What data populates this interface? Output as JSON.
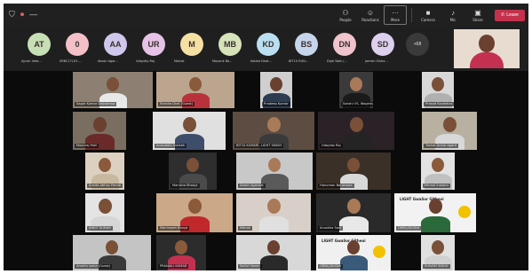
{
  "toolbar": {
    "shield_icon": "shield-icon",
    "record_indicator": "⏺",
    "timer": "—",
    "buttons": [
      {
        "label": "People",
        "icon": "people-icon"
      },
      {
        "label": "Reactions",
        "icon": "reactions-icon"
      },
      {
        "label": "More",
        "icon": "more-icon"
      },
      {
        "label": "Camera",
        "icon": "camera-icon"
      },
      {
        "label": "Mic",
        "icon": "mic-icon"
      },
      {
        "label": "Share",
        "icon": "share-icon"
      }
    ],
    "leave_label": "Leave",
    "leave_color": "#c4314b"
  },
  "strip": {
    "participants": [
      {
        "initials": "AT",
        "name": "Ayush Veta...",
        "color": "#c7dfb5"
      },
      {
        "initials": "0",
        "name": "0RBC17/1f1...",
        "color": "#f3c0c8"
      },
      {
        "initials": "AA",
        "name": "Akash Agar...",
        "color": "#cfc8ec"
      },
      {
        "initials": "UR",
        "name": "Udaydip Raj",
        "color": "#e6c2e6"
      },
      {
        "initials": "M",
        "name": "Mahak",
        "color": "#f5e0a3"
      },
      {
        "initials": "MB",
        "name": "Mayank Bo...",
        "color": "#d6e3b9"
      },
      {
        "initials": "KD",
        "name": "Kalata Dhat...",
        "color": "#b9dff0"
      },
      {
        "initials": "BS",
        "name": "BIT10 RUN...",
        "color": "#c6d4ec"
      },
      {
        "initials": "DN",
        "name": "Dipti Naik (...",
        "color": "#efc4cc"
      },
      {
        "initials": "SD",
        "name": "jomish Sinha...",
        "color": "#ddd0ee"
      }
    ],
    "more_count": "+68"
  },
  "grid": {
    "tiles": [
      {
        "name": "Sagar Kumar Dwivahrya",
        "bg": "#8d8072",
        "skin": "#7a5038",
        "shirt": "#e8e8e8"
      },
      {
        "name": "Ekshita Dixit (Guest)",
        "bg": "#bba58e",
        "skin": "#8a5a3a",
        "shirt": "#b8323c"
      },
      {
        "name": "Pradeep Kumar",
        "bg": "#cfcfcf",
        "skin": "#6a4030",
        "shirt": "#2d3c50"
      },
      {
        "name": "Sakshi VS. Waghmare",
        "bg": "#3a3a3a",
        "skin": "#a97a58",
        "shirt": "#1a1a1a"
      },
      {
        "name": "Prasad Kondekar",
        "bg": "#d8d8d8",
        "skin": "#7a5038",
        "shirt": "#b0b0b0"
      },
      {
        "name": "Moonraj Mall",
        "bg": "#7a6e60",
        "skin": "#6a4030",
        "shirt": "#6a2a2a"
      },
      {
        "name": "Anisuddin Sullabh",
        "bg": "#e0e0e0",
        "skin": "#7a5038",
        "shirt": "#3e4d6a"
      },
      {
        "name": "BIT10 KUMARI, LIGHT SINGH",
        "bg": "#5c4c42",
        "skin": "#a97a58",
        "shirt": "#3a3a3a"
      },
      {
        "name": "Udaydip Raj",
        "bg": "#2a2226",
        "skin": "#7a5038",
        "shirt": "#242424"
      },
      {
        "name": "Tushar Amuk Agard",
        "bg": "#b8b0a0",
        "skin": "#7a5038",
        "shirt": "#d8d8d8"
      },
      {
        "name": "Ankita Abhay Pande",
        "bg": "#dcd0c0",
        "skin": "#8a5a3a",
        "shirt": "#c8b8a0"
      },
      {
        "name": "Manisha Bhauja",
        "bg": "#2e2e2e",
        "skin": "#7a5038",
        "shirt": "#4a4a4a"
      },
      {
        "name": "Akash Agarwal",
        "bg": "#c8c8c8",
        "skin": "#a97a58",
        "shirt": "#5a5a5a"
      },
      {
        "name": "Hanuman Baranwaa",
        "bg": "#3a3028",
        "skin": "#7a5038",
        "shirt": "#d8d8d8"
      },
      {
        "name": "Mirmal Inoland",
        "bg": "#e2e2e2",
        "skin": "#8a5a3a",
        "shirt": "#c0c0c0"
      },
      {
        "name": "ANKIT KUMAR",
        "bg": "#e4e4e4",
        "skin": "#7a5038",
        "shirt": "#d6d6d6"
      },
      {
        "name": "Mahimjeet Banya",
        "bg": "#caa888",
        "skin": "#8a5a3a",
        "shirt": "#c0282c"
      },
      {
        "name": "Mehak",
        "bg": "#d8d0c8",
        "skin": "#a97a58",
        "shirt": "#e0e0e0"
      },
      {
        "name": "Anushka Soni",
        "bg": "#2a2a2a",
        "skin": "#a97a58",
        "shirt": "#e8e8e8"
      },
      {
        "name": "ORBC/GIOSHI",
        "bg": "#f2f2f2",
        "skin": "#6a4030",
        "shirt": "#2a6a3a",
        "logo": true
      },
      {
        "name": "Ananta soma (Guest)",
        "bg": "#c4c4c4",
        "skin": "#7a5038",
        "shirt": "#3a3a3a"
      },
      {
        "name": "PRANJALI KUMAR",
        "bg": "#2c2c2c",
        "skin": "#8a5a3a",
        "shirt": "#c43050"
      },
      {
        "name": "Saiful Haven",
        "bg": "#d8d8d8",
        "skin": "#6a4030",
        "shirt": "#2a2a2a"
      },
      {
        "name": "ORBC/GIOSHI",
        "bg": "#f0f0f0",
        "skin": "#6a4030",
        "shirt": "#3a5a7a",
        "logo": true
      },
      {
        "name": "SHIVAM SINGH",
        "bg": "#e0e0e0",
        "skin": "#7a5038",
        "shirt": "#d0d0d0"
      }
    ],
    "logo_text": "LIGHT Gwalior Githeoi"
  }
}
